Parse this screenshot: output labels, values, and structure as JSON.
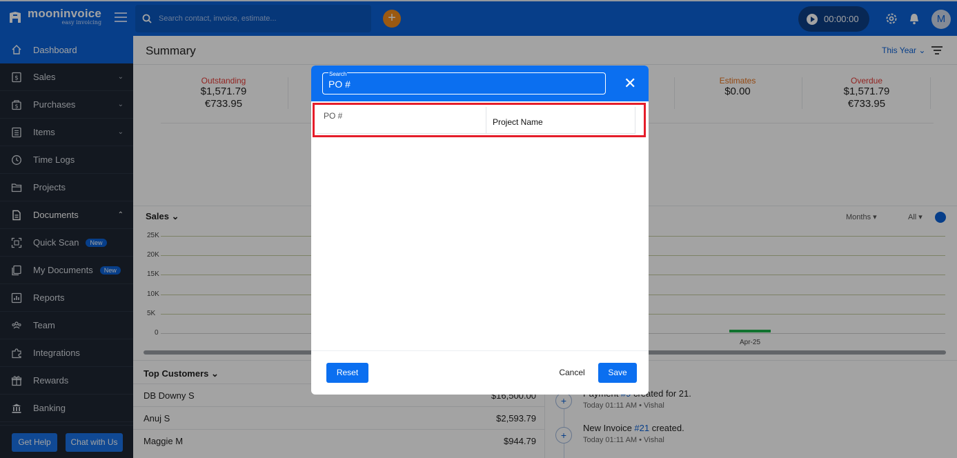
{
  "app": {
    "brand": "mooninvoice",
    "tagline": "easy invoicing"
  },
  "topbar": {
    "search_placeholder": "Search contact, invoice, estimate...",
    "timer": "00:00:00",
    "avatar_initial": "M"
  },
  "sidebar": {
    "items": [
      {
        "label": "Dashboard",
        "icon": "home-icon"
      },
      {
        "label": "Sales",
        "icon": "dollar-doc-icon"
      },
      {
        "label": "Purchases",
        "icon": "bag-icon"
      },
      {
        "label": "Items",
        "icon": "list-icon"
      },
      {
        "label": "Time Logs",
        "icon": "clock-icon"
      },
      {
        "label": "Projects",
        "icon": "folder-icon"
      },
      {
        "label": "Documents",
        "icon": "document-icon"
      },
      {
        "label": "Quick Scan",
        "icon": "scan-icon",
        "badge": "New"
      },
      {
        "label": "My Documents",
        "icon": "my-documents-icon",
        "badge": "New"
      },
      {
        "label": "Reports",
        "icon": "reports-icon"
      },
      {
        "label": "Team",
        "icon": "team-icon"
      },
      {
        "label": "Integrations",
        "icon": "puzzle-icon"
      },
      {
        "label": "Rewards",
        "icon": "gift-icon"
      },
      {
        "label": "Banking",
        "icon": "bank-icon"
      }
    ],
    "get_help": "Get Help",
    "chat": "Chat with Us"
  },
  "summary": {
    "title": "Summary",
    "period": "This Year",
    "stats": [
      {
        "label": "Outstanding",
        "values": [
          "$1,571.79",
          "€733.95"
        ],
        "color": "#e53935"
      },
      {
        "label": "Estimates",
        "values": [
          "$0.00"
        ],
        "color": "#e6711c"
      },
      {
        "label": "Overdue",
        "values": [
          "$1,571.79",
          "€733.95"
        ],
        "color": "#e53935"
      }
    ]
  },
  "sales": {
    "title": "Sales",
    "months_label": "Months",
    "all_label": "All",
    "y_ticks": [
      "25K",
      "20K",
      "15K",
      "10K",
      "5K",
      "0"
    ],
    "x_label": "Apr-25"
  },
  "chart_data": {
    "type": "bar",
    "categories": [
      "Apr-25"
    ],
    "values": [
      350
    ],
    "ylim": [
      0,
      25000
    ],
    "y_ticks": [
      "25K",
      "20K",
      "15K",
      "10K",
      "5K",
      "0"
    ]
  },
  "top_customers": {
    "title": "Top Customers",
    "rows": [
      {
        "name": "DB Downy S",
        "amount": "$16,500.00"
      },
      {
        "name": "Anuj S",
        "amount": "$2,593.79"
      },
      {
        "name": "Maggie M",
        "amount": "$944.79"
      }
    ]
  },
  "activity": [
    {
      "prefix": "Payment ",
      "link": "#9",
      "suffix": " created for 21.",
      "meta": "Today 01:11 AM • Vishal"
    },
    {
      "prefix": "New Invoice ",
      "link": "#21",
      "suffix": " created.",
      "meta": "Today 01:11 AM • Vishal"
    }
  ],
  "modal": {
    "search_label": "Search",
    "search_value": "PO #",
    "col1": "PO #",
    "col2": "Project Name",
    "reset": "Reset",
    "cancel": "Cancel",
    "save": "Save"
  }
}
